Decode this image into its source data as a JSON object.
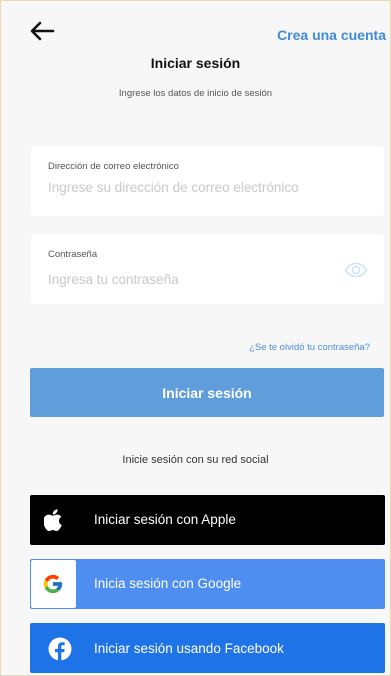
{
  "header": {
    "back_icon": "arrow-left-icon",
    "create_account": "Crea una cuenta",
    "title": "Iniciar sesión",
    "subtitle": "Ingrese los datos de inicio de sesión"
  },
  "form": {
    "email": {
      "label": "Dirección de correo electrónico",
      "placeholder": "Ingrese su dirección de correo electrónico",
      "value": ""
    },
    "password": {
      "label": "Contraseña",
      "placeholder": "Ingresa tu contraseña",
      "value": "",
      "toggle_icon": "eye-icon"
    },
    "forgot_password": "¿Se te olvidó tu contraseña?",
    "submit_label": "Iniciar sesión"
  },
  "social": {
    "caption": "Inicie sesión con su red social",
    "apple": {
      "label": "Iniciar sesión con Apple",
      "icon": "apple-icon"
    },
    "google": {
      "label": "Inicia sesión con Google",
      "icon": "google-icon"
    },
    "facebook": {
      "label": "Iniciar sesión usando Facebook",
      "icon": "facebook-icon"
    }
  },
  "colors": {
    "accent": "#3f8bd6",
    "login_button": "#5f9ddb",
    "apple_button": "#000000",
    "google_button": "#4d8ef0",
    "facebook_button": "#1e73e6",
    "background": "#f7f7f7"
  }
}
